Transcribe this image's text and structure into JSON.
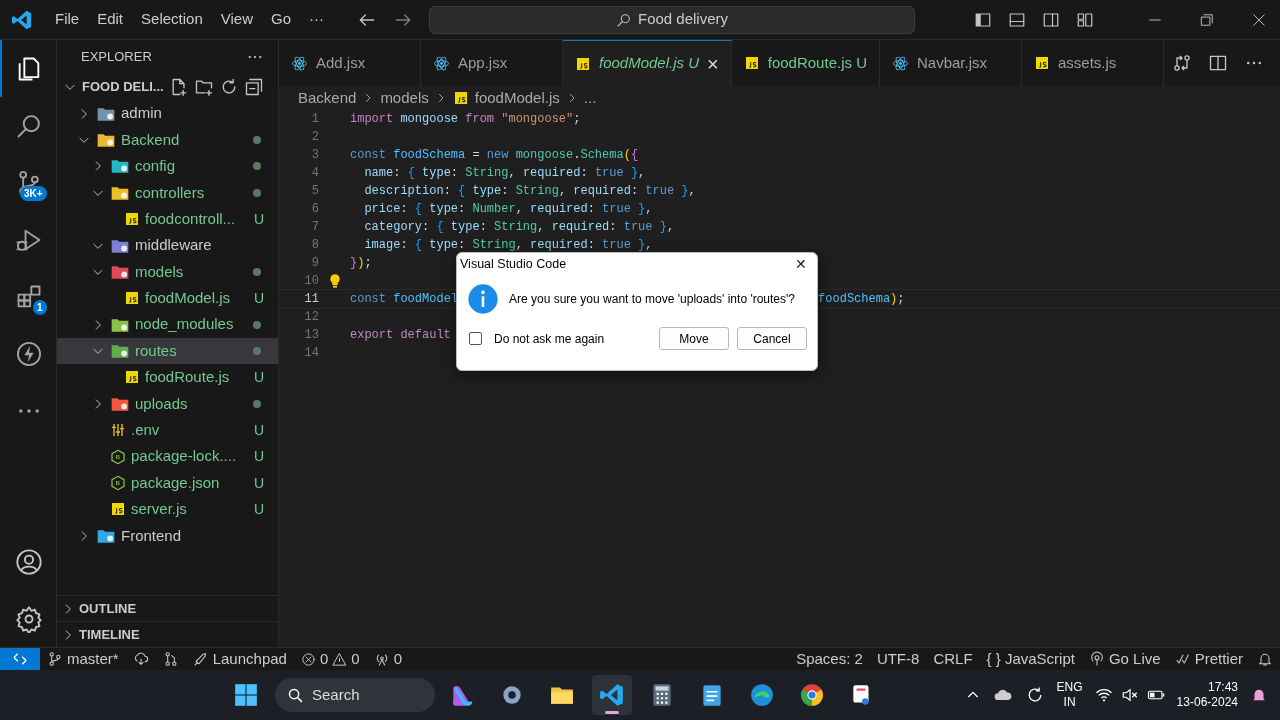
{
  "title_bar": {
    "menus": [
      "File",
      "Edit",
      "Selection",
      "View",
      "Go"
    ],
    "more": "···",
    "search": "Food delivery"
  },
  "activity_bar": {
    "items": [
      {
        "kind": "files",
        "selected": true
      },
      {
        "kind": "search",
        "selected": false
      },
      {
        "kind": "source-control",
        "selected": false,
        "badge": "3K+"
      },
      {
        "kind": "run",
        "selected": false
      },
      {
        "kind": "extensions",
        "selected": false,
        "badge": "1"
      },
      {
        "kind": "bolt",
        "selected": false
      },
      {
        "kind": "more",
        "selected": false
      }
    ],
    "bottom": [
      {
        "kind": "account"
      },
      {
        "kind": "settings"
      }
    ]
  },
  "sidebar": {
    "title": "EXPLORER",
    "root": {
      "label": "FOOD DELI...",
      "expanded": true
    },
    "tree": [
      {
        "name": "admin",
        "kind": "folder",
        "color": "#7393ab",
        "expanded": false,
        "untracked": false,
        "dot": false,
        "selected": false
      },
      {
        "name": "Backend",
        "kind": "folder",
        "color": "#e8b931",
        "expanded": true,
        "untracked": true,
        "dot": true,
        "selected": false,
        "children": [
          {
            "name": "config",
            "kind": "folder",
            "color": "#25b5c4",
            "expanded": false,
            "untracked": true,
            "dot": true,
            "selected": false
          },
          {
            "name": "controllers",
            "kind": "folder",
            "color": "#e8c224",
            "expanded": true,
            "untracked": true,
            "dot": true,
            "selected": false,
            "children": [
              {
                "name": "foodcontroll...",
                "kind": "js",
                "status": "U",
                "untracked": true,
                "selected": false
              }
            ]
          },
          {
            "name": "middleware",
            "kind": "folder",
            "color": "#7b7fd6",
            "expanded": true,
            "untracked": false,
            "dot": false,
            "selected": false
          },
          {
            "name": "models",
            "kind": "folder",
            "color": "#e0495a",
            "expanded": true,
            "untracked": true,
            "dot": true,
            "selected": false,
            "children": [
              {
                "name": "foodModel.js",
                "kind": "js",
                "status": "U",
                "untracked": true,
                "selected": false
              }
            ]
          },
          {
            "name": "node_modules",
            "kind": "folder",
            "color": "#8bc34a",
            "expanded": false,
            "untracked": true,
            "dot": true,
            "selected": false
          },
          {
            "name": "routes",
            "kind": "folder",
            "color": "#5fae4a",
            "expanded": true,
            "untracked": true,
            "dot": true,
            "selected": true,
            "children": [
              {
                "name": "foodRoute.js",
                "kind": "js",
                "status": "U",
                "untracked": true,
                "selected": false
              }
            ]
          },
          {
            "name": "uploads",
            "kind": "folder",
            "color": "#f0573e",
            "expanded": false,
            "untracked": true,
            "dot": true,
            "selected": false
          },
          {
            "name": ".env",
            "kind": "env",
            "status": "U",
            "untracked": true,
            "selected": false
          },
          {
            "name": "package-lock....",
            "kind": "json",
            "status": "U",
            "untracked": true,
            "selected": false
          },
          {
            "name": "package.json",
            "kind": "json",
            "status": "U",
            "untracked": true,
            "selected": false
          },
          {
            "name": "server.js",
            "kind": "js",
            "status": "U",
            "untracked": true,
            "selected": false
          }
        ]
      },
      {
        "name": "Frontend",
        "kind": "folder",
        "color": "#2fa7e8",
        "expanded": false,
        "untracked": false,
        "dot": false,
        "selected": false
      }
    ],
    "sections": [
      {
        "label": "OUTLINE",
        "expanded": false
      },
      {
        "label": "TIMELINE",
        "expanded": false
      }
    ]
  },
  "tabs": [
    {
      "label": "Add.jsx",
      "kind": "react",
      "selected": false,
      "preview": false
    },
    {
      "label": "App.jsx",
      "kind": "react",
      "selected": false,
      "preview": false
    },
    {
      "label": "foodModel.js",
      "kind": "js",
      "selected": true,
      "preview": true,
      "status": "U",
      "close": "×"
    },
    {
      "label": "foodRoute.js",
      "kind": "js",
      "selected": false,
      "preview": false,
      "status": "U"
    },
    {
      "label": "Navbar.jsx",
      "kind": "react",
      "selected": false,
      "preview": false
    },
    {
      "label": "assets.js",
      "kind": "js",
      "selected": false,
      "preview": false
    }
  ],
  "breadcrumb": [
    {
      "label": "Backend",
      "kind": "folder"
    },
    {
      "label": "models",
      "kind": "folder"
    },
    {
      "label": "foodModel.js",
      "kind": "js"
    },
    {
      "label": "...",
      "kind": "more"
    }
  ],
  "code": [
    {
      "number": "1",
      "tokens": [
        {
          "kind": "kw",
          "t": "import "
        },
        {
          "kind": "prop",
          "t": "mongoose "
        },
        {
          "kind": "kw",
          "t": "from "
        },
        {
          "kind": "str",
          "t": "\"mongoose\""
        },
        {
          "kind": "p",
          "t": ";"
        }
      ]
    },
    {
      "number": "2"
    },
    {
      "number": "3",
      "tokens": [
        {
          "kind": "st",
          "t": "const "
        },
        {
          "kind": "var",
          "t": "foodSchema "
        },
        {
          "kind": "p",
          "t": "= "
        },
        {
          "kind": "st",
          "t": "new "
        },
        {
          "kind": "cls",
          "t": "mongoose"
        },
        {
          "kind": "p",
          "t": "."
        },
        {
          "kind": "cls",
          "t": "Schema"
        },
        {
          "kind": "b1",
          "t": "("
        },
        {
          "kind": "b2",
          "t": "{"
        }
      ]
    },
    {
      "number": "4",
      "tokens": [
        {
          "kind": "prop",
          "t": "  name"
        },
        {
          "kind": "p",
          "t": ": "
        },
        {
          "kind": "b3",
          "t": "{ "
        },
        {
          "kind": "prop",
          "t": "type"
        },
        {
          "kind": "p",
          "t": ": "
        },
        {
          "kind": "cls",
          "t": "String"
        },
        {
          "kind": "p",
          "t": ", "
        },
        {
          "kind": "prop",
          "t": "required"
        },
        {
          "kind": "p",
          "t": ": "
        },
        {
          "kind": "st",
          "t": "true "
        },
        {
          "kind": "b3",
          "t": "}"
        },
        {
          "kind": "p",
          "t": ","
        }
      ]
    },
    {
      "number": "5",
      "tokens": [
        {
          "kind": "prop",
          "t": "  description"
        },
        {
          "kind": "p",
          "t": ": "
        },
        {
          "kind": "b3",
          "t": "{ "
        },
        {
          "kind": "prop",
          "t": "type"
        },
        {
          "kind": "p",
          "t": ": "
        },
        {
          "kind": "cls",
          "t": "String"
        },
        {
          "kind": "p",
          "t": ", "
        },
        {
          "kind": "prop",
          "t": "required"
        },
        {
          "kind": "p",
          "t": ": "
        },
        {
          "kind": "st",
          "t": "true "
        },
        {
          "kind": "b3",
          "t": "}"
        },
        {
          "kind": "p",
          "t": ","
        }
      ]
    },
    {
      "number": "6",
      "tokens": [
        {
          "kind": "prop",
          "t": "  price"
        },
        {
          "kind": "p",
          "t": ": "
        },
        {
          "kind": "b3",
          "t": "{ "
        },
        {
          "kind": "prop",
          "t": "type"
        },
        {
          "kind": "p",
          "t": ": "
        },
        {
          "kind": "cls",
          "t": "Number"
        },
        {
          "kind": "p",
          "t": ", "
        },
        {
          "kind": "prop",
          "t": "required"
        },
        {
          "kind": "p",
          "t": ": "
        },
        {
          "kind": "st",
          "t": "true "
        },
        {
          "kind": "b3",
          "t": "}"
        },
        {
          "kind": "p",
          "t": ","
        }
      ]
    },
    {
      "number": "7",
      "tokens": [
        {
          "kind": "prop",
          "t": "  category"
        },
        {
          "kind": "p",
          "t": ": "
        },
        {
          "kind": "b3",
          "t": "{ "
        },
        {
          "kind": "prop",
          "t": "type"
        },
        {
          "kind": "p",
          "t": ": "
        },
        {
          "kind": "cls",
          "t": "String"
        },
        {
          "kind": "p",
          "t": ", "
        },
        {
          "kind": "prop",
          "t": "required"
        },
        {
          "kind": "p",
          "t": ": "
        },
        {
          "kind": "st",
          "t": "true "
        },
        {
          "kind": "b3",
          "t": "}"
        },
        {
          "kind": "p",
          "t": ","
        }
      ]
    },
    {
      "number": "8",
      "tokens": [
        {
          "kind": "prop",
          "t": "  image"
        },
        {
          "kind": "p",
          "t": ": "
        },
        {
          "kind": "b3",
          "t": "{ "
        },
        {
          "kind": "prop",
          "t": "type"
        },
        {
          "kind": "p",
          "t": ": "
        },
        {
          "kind": "cls",
          "t": "String"
        },
        {
          "kind": "p",
          "t": ", "
        },
        {
          "kind": "prop",
          "t": "required"
        },
        {
          "kind": "p",
          "t": ": "
        },
        {
          "kind": "st",
          "t": "true "
        },
        {
          "kind": "b3",
          "t": "}"
        },
        {
          "kind": "p",
          "t": ","
        }
      ]
    },
    {
      "number": "9",
      "tokens": [
        {
          "kind": "b2",
          "t": "}"
        },
        {
          "kind": "b1",
          "t": ")"
        },
        {
          "kind": "p",
          "t": ";"
        }
      ]
    },
    {
      "number": "10",
      "lightbulb": true
    },
    {
      "number": "11",
      "current": true,
      "tokens": [
        {
          "kind": "st",
          "t": "const "
        },
        {
          "kind": "var",
          "t": "foodModel"
        }
      ],
      "tail": [
        {
          "kind": "var",
          "t": "foodSchema"
        },
        {
          "kind": "b1",
          "t": ")"
        },
        {
          "kind": "p",
          "t": ";"
        }
      ]
    },
    {
      "number": "12"
    },
    {
      "number": "13",
      "tokens": [
        {
          "kind": "kw",
          "t": "export default"
        }
      ]
    },
    {
      "number": "14"
    }
  ],
  "dialog": {
    "title": "Visual Studio Code",
    "close": "✕",
    "message": "Are you sure you want to move 'uploads' into 'routes'?",
    "checkbox": {
      "label": "Do not ask me again",
      "checked": false
    },
    "buttons": [
      {
        "label": "Move"
      },
      {
        "label": "Cancel"
      }
    ]
  },
  "status_bar": {
    "left": [
      {
        "kind": "remote"
      },
      {
        "kind": "branch",
        "text": "master*"
      },
      {
        "kind": "sync"
      },
      {
        "kind": "compare"
      },
      {
        "kind": "launchpad",
        "text": "Launchpad"
      },
      {
        "kind": "problems",
        "errors": "0",
        "warnings": "0"
      },
      {
        "kind": "ports",
        "text": "0"
      }
    ],
    "right": [
      {
        "kind": "text",
        "text": "Spaces: 2"
      },
      {
        "kind": "text",
        "text": "UTF-8"
      },
      {
        "kind": "text",
        "text": "CRLF"
      },
      {
        "kind": "language",
        "glyph": "{ }",
        "text": "JavaScript"
      },
      {
        "kind": "golive",
        "text": "Go Live"
      },
      {
        "kind": "prettier",
        "text": "Prettier"
      },
      {
        "kind": "bell"
      }
    ]
  },
  "taskbar": {
    "search": "Search",
    "apps": [
      {
        "kind": "copilot",
        "selected": false
      },
      {
        "kind": "settings",
        "selected": false
      },
      {
        "kind": "folder",
        "selected": false
      },
      {
        "kind": "vscode",
        "selected": true
      },
      {
        "kind": "calculator",
        "selected": false
      },
      {
        "kind": "notepad",
        "selected": false
      },
      {
        "kind": "edge",
        "selected": false
      },
      {
        "kind": "chrome",
        "selected": false
      },
      {
        "kind": "snipping",
        "selected": false
      }
    ],
    "tray": {
      "language": "ENG",
      "region": "IN",
      "time": "17:43",
      "date": "13-06-2024"
    }
  }
}
